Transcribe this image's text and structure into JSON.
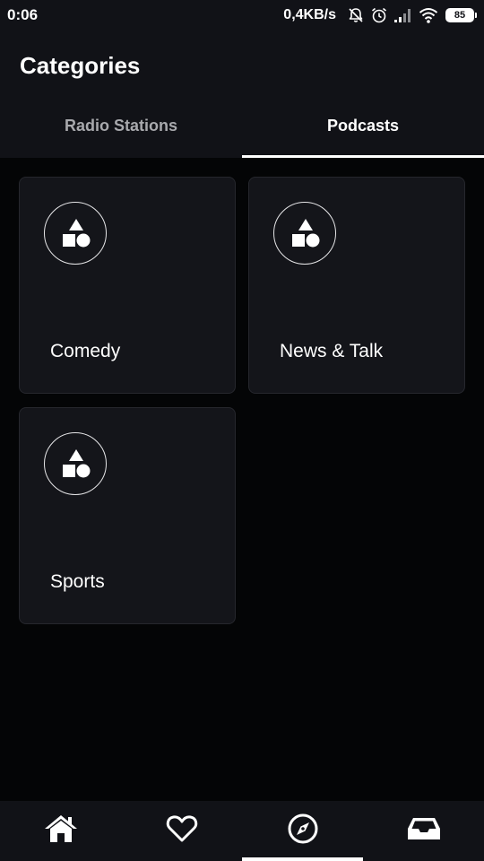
{
  "status_bar": {
    "time": "0:06",
    "net_speed": "0,4KB/s",
    "battery": "85",
    "icons": [
      "mute-bell-icon",
      "alarm-icon",
      "signal-icon",
      "wifi-icon",
      "battery-icon"
    ]
  },
  "header": {
    "title": "Categories"
  },
  "tabs": [
    {
      "label": "Radio Stations",
      "active": false
    },
    {
      "label": "Podcasts",
      "active": true
    }
  ],
  "categories": [
    {
      "label": "Comedy",
      "icon": "shapes-icon"
    },
    {
      "label": "News & Talk",
      "icon": "shapes-icon"
    },
    {
      "label": "Sports",
      "icon": "shapes-icon"
    }
  ],
  "bottom_nav": [
    {
      "name": "home",
      "icon": "home-icon",
      "active": false
    },
    {
      "name": "favorites",
      "icon": "heart-icon",
      "active": false
    },
    {
      "name": "browse",
      "icon": "compass-icon",
      "active": true
    },
    {
      "name": "inbox",
      "icon": "inbox-icon",
      "active": false
    }
  ],
  "colors": {
    "background": "#040506",
    "surface": "#111217",
    "card": "#14151a",
    "card_border": "#26272d",
    "text_primary": "#ffffff",
    "text_inactive": "#a8a9ad",
    "indicator": "#ffffff"
  }
}
